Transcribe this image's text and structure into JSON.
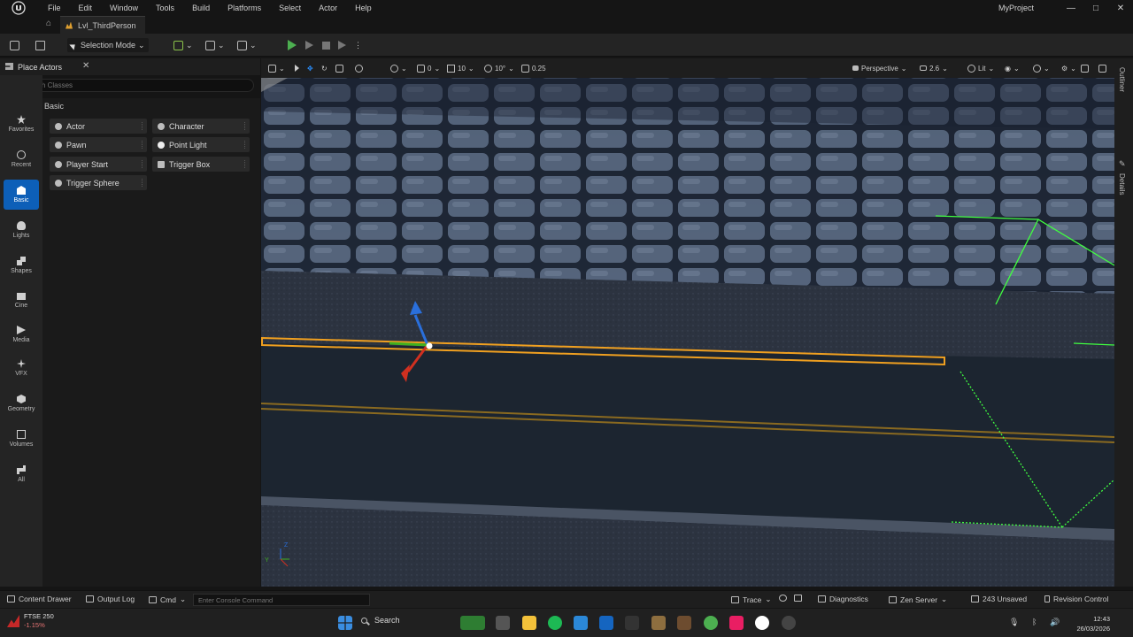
{
  "menu": {
    "items": [
      "File",
      "Edit",
      "Window",
      "Tools",
      "Build",
      "Platforms",
      "Select",
      "Actor",
      "Help"
    ],
    "project": "MyProject"
  },
  "tab": {
    "level_name": "Lvl_ThirdPerson"
  },
  "toolbar": {
    "mode_label": "Selection Mode"
  },
  "place_actors": {
    "title": "Place Actors",
    "search_placeholder": "Search Classes",
    "category": "Basic",
    "actors": [
      "Actor",
      "Character",
      "Pawn",
      "Point Light",
      "Player Start",
      "Trigger Box",
      "Trigger Sphere"
    ]
  },
  "modes": [
    "Favorites",
    "Recent",
    "Basic",
    "Lights",
    "Shapes",
    "Cine",
    "Media",
    "VFX",
    "Geometry",
    "Volumes",
    "All"
  ],
  "viewport": {
    "grid_snap": "10",
    "rotation_snap": "10°",
    "scale_snap": "0.25",
    "camera_mode": "Perspective",
    "camera_speed": "2.6",
    "view_mode": "Lit",
    "rot_value": "0",
    "axis_y": "Y",
    "axis_z": "Z"
  },
  "right_strip": {
    "outliner": "Outliner",
    "details": "Details"
  },
  "statusbar": {
    "content_drawer": "Content Drawer",
    "output_log": "Output Log",
    "cmd": "Cmd",
    "console_placeholder": "Enter Console Command",
    "trace": "Trace",
    "diagnostics": "Diagnostics",
    "zen_server": "Zen Server",
    "unsaved": "243 Unsaved",
    "revision_control": "Revision Control"
  },
  "taskbar": {
    "stock_name": "FTSE 250",
    "stock_change": "-1.15%",
    "search_label": "Search",
    "time": "12:43",
    "date": "26/03/2026"
  },
  "colors": {
    "accent": "#0d5fb8",
    "play": "#4caf50",
    "selection": "#f0a020",
    "gizmo_x": "#d03020",
    "gizmo_y": "#40b020",
    "gizmo_z": "#2a6fdb",
    "bounds": "#40ff40"
  }
}
